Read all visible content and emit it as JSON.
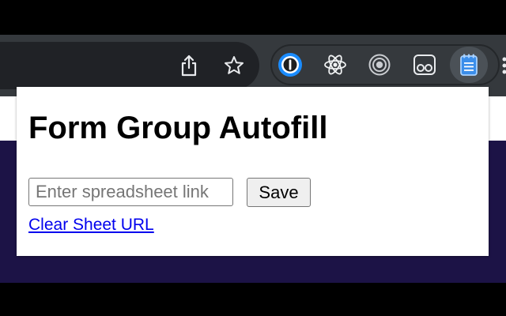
{
  "popup": {
    "title": "Form Group Autofill",
    "sheet_input": {
      "value": "",
      "placeholder": "Enter spreadsheet link"
    },
    "save_label": "Save",
    "clear_link_label": "Clear Sheet URL"
  },
  "toolbar": {
    "share_icon": "share-icon",
    "bookmark_icon": "star-icon",
    "extensions": [
      "onepassword-extension-icon",
      "react-devtools-extension-icon",
      "record-extension-icon",
      "cassette-extension-icon",
      "notepad-extension-icon"
    ]
  },
  "colors": {
    "toolbar": "#35393d",
    "omnibox": "#202226",
    "page_background": "#1c1346",
    "link": "#0000ee",
    "active_extension": "#1a73e8"
  }
}
